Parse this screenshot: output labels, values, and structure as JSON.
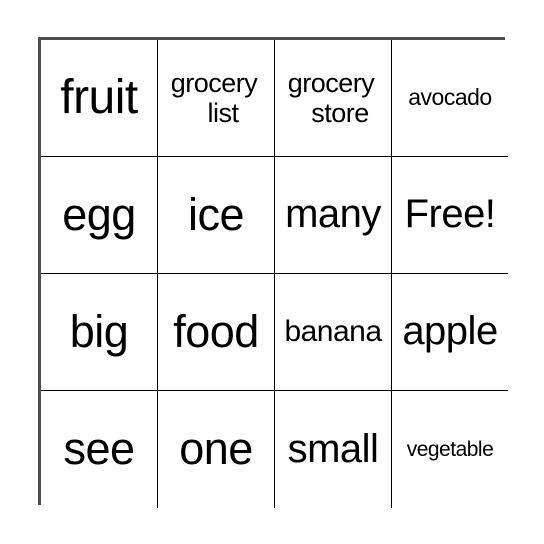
{
  "card": {
    "type": "bingo-card",
    "columns": 4,
    "rows": 4,
    "free_space_label": "Free!",
    "text_color": "#000000",
    "background_color": "#ffffff",
    "border_color": "#4d4d4d",
    "grid_line_color": "#000000",
    "cells": [
      {
        "id": "r1c1",
        "text": "fruit",
        "size": "fs-xl",
        "lines": 1
      },
      {
        "id": "r1c2",
        "text": "grocery list",
        "size": "fs-xs",
        "lines": 2,
        "line1": "grocery",
        "line2": "list"
      },
      {
        "id": "r1c3",
        "text": "grocery store",
        "size": "fs-xs",
        "lines": 2,
        "line1": "grocery",
        "line2": "store"
      },
      {
        "id": "r1c4",
        "text": "avocado",
        "size": "fs-xxs",
        "lines": 1
      },
      {
        "id": "r2c1",
        "text": "egg",
        "size": "fs-lg",
        "lines": 1
      },
      {
        "id": "r2c2",
        "text": "ice",
        "size": "fs-lg",
        "lines": 1
      },
      {
        "id": "r2c3",
        "text": "many",
        "size": "fs-md",
        "lines": 1
      },
      {
        "id": "r2c4",
        "text": "Free!",
        "size": "fs-md",
        "lines": 1
      },
      {
        "id": "r3c1",
        "text": "big",
        "size": "fs-lg",
        "lines": 1
      },
      {
        "id": "r3c2",
        "text": "food",
        "size": "fs-lg",
        "lines": 1
      },
      {
        "id": "r3c3",
        "text": "banana",
        "size": "fs-sm",
        "lines": 1
      },
      {
        "id": "r3c4",
        "text": "apple",
        "size": "fs-md",
        "lines": 1
      },
      {
        "id": "r4c1",
        "text": "see",
        "size": "fs-lg",
        "lines": 1
      },
      {
        "id": "r4c2",
        "text": "one",
        "size": "fs-lg",
        "lines": 1
      },
      {
        "id": "r4c3",
        "text": "small",
        "size": "fs-md",
        "lines": 1
      },
      {
        "id": "r4c4",
        "text": "vegetable",
        "size": "fs-tiny",
        "lines": 1
      }
    ]
  }
}
